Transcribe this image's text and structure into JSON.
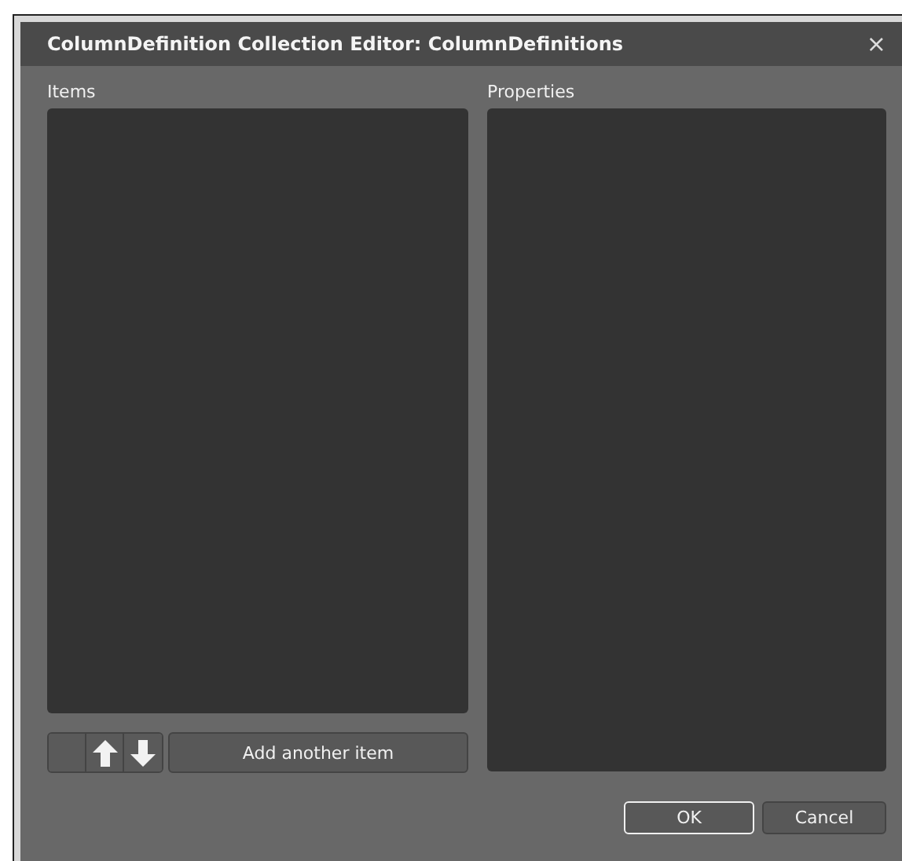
{
  "window": {
    "title": "ColumnDefinition Collection Editor: ColumnDefinitions",
    "close": "×"
  },
  "items_panel": {
    "label": "Items",
    "add_button": "Add another item"
  },
  "properties_panel": {
    "label": "Properties"
  },
  "buttons": [
    {
      "label": "OK",
      "default": true
    },
    {
      "label": "Cancel",
      "default": false
    }
  ]
}
